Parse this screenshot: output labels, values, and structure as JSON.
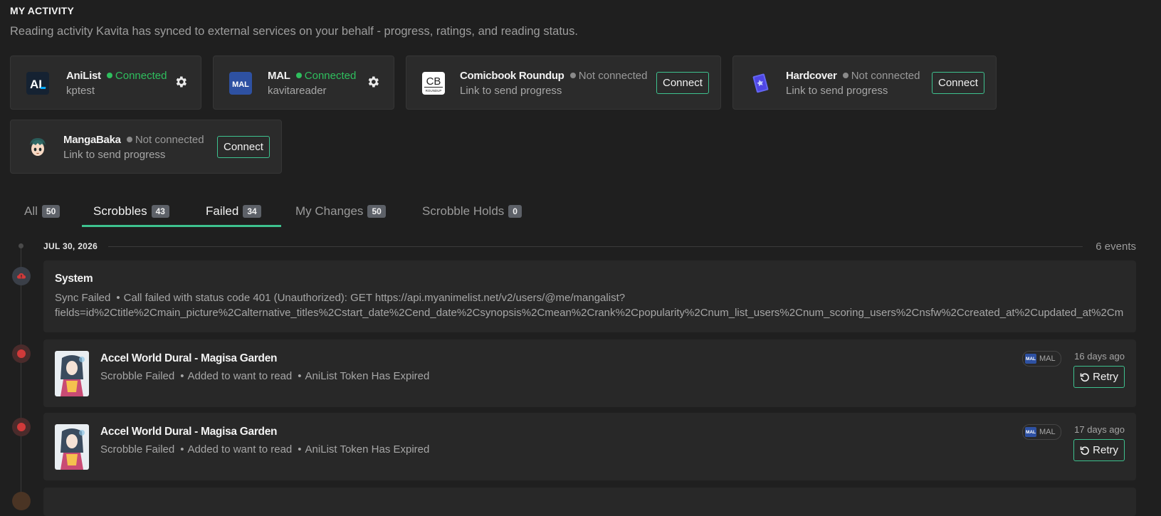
{
  "page": {
    "title": "MY ACTIVITY",
    "subtitle": "Reading activity Kavita has synced to external services on your behalf - progress, ratings, and reading status."
  },
  "services": [
    {
      "name": "AniList",
      "status": "Connected",
      "sub": "kptest",
      "action": "settings",
      "icon": "anilist-logo"
    },
    {
      "name": "MAL",
      "status": "Connected",
      "sub": "kavitareader",
      "action": "settings",
      "icon": "mal-logo"
    },
    {
      "name": "Comicbook Roundup",
      "status": "Not connected",
      "sub": "Link to send progress",
      "action": "Connect",
      "icon": "cbr-logo"
    },
    {
      "name": "Hardcover",
      "status": "Not connected",
      "sub": "Link to send progress",
      "action": "Connect",
      "icon": "hardcover-logo"
    },
    {
      "name": "MangaBaka",
      "status": "Not connected",
      "sub": "Link to send progress",
      "action": "Connect",
      "icon": "mangabaka-logo"
    }
  ],
  "logos": {
    "anilist": "AL",
    "mal": "MAL",
    "cbr": "CB",
    "cbr_small": "ROUNDUP"
  },
  "tabs": [
    {
      "label": "All",
      "count": "50"
    },
    {
      "label": "Scrobbles",
      "count": "43"
    },
    {
      "label": "Failed",
      "count": "34"
    },
    {
      "label": "My Changes",
      "count": "50"
    },
    {
      "label": "Scrobble Holds",
      "count": "0"
    }
  ],
  "active_tab": "Failed",
  "timeline": {
    "date": "JUL 30, 2026",
    "count": "6 events"
  },
  "system_event": {
    "title": "System",
    "status": "Sync Failed",
    "message": "Call failed with status code 401 (Unauthorized): GET https://api.myanimelist.net/v2/users/@me/mangalist?",
    "message2": "fields=id%2Ctitle%2Cmain_picture%2Calternative_titles%2Cstart_date%2Cend_date%2Csynopsis%2Cmean%2Crank%2Cpopularity%2Cnum_list_users%2Cnum_scoring_users%2Cnsfw%2Ccreated_at%2Cupdated_at%2Cm"
  },
  "events": [
    {
      "title": "Accel World Dural - Magisa Garden",
      "status": "Scrobble Failed",
      "action": "Added to want to read",
      "error": "AniList Token Has Expired",
      "source": "MAL",
      "time": "16 days ago",
      "button": "Retry"
    },
    {
      "title": "Accel World Dural - Magisa Garden",
      "status": "Scrobble Failed",
      "action": "Added to want to read",
      "error": "AniList Token Has Expired",
      "source": "MAL",
      "time": "17 days ago",
      "button": "Retry"
    }
  ],
  "colors": {
    "accent": "#3ec28f",
    "connected": "#2fbf5e",
    "failed": "#d03a3a"
  }
}
